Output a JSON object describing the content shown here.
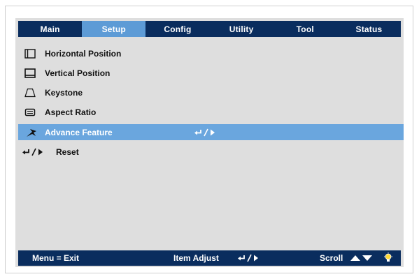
{
  "tabs": [
    {
      "label": "Main"
    },
    {
      "label": "Setup"
    },
    {
      "label": "Config"
    },
    {
      "label": "Utility"
    },
    {
      "label": "Tool"
    },
    {
      "label": "Status"
    }
  ],
  "active_tab": "Setup",
  "menu_items": [
    {
      "label": "Horizontal Position",
      "icon": "horizontal-position-icon"
    },
    {
      "label": "Vertical Position",
      "icon": "vertical-position-icon"
    },
    {
      "label": "Keystone",
      "icon": "keystone-icon"
    },
    {
      "label": "Aspect Ratio",
      "icon": "aspect-ratio-icon"
    },
    {
      "label": "Advance Feature",
      "icon": "advance-feature-icon",
      "selected": true
    },
    {
      "label": "Reset",
      "icon": "enter-right-icon"
    }
  ],
  "statusbar": {
    "exit": "Menu = Exit",
    "item_adjust": "Item Adjust",
    "scroll": "Scroll"
  },
  "colors": {
    "bar": "#0a2d5e",
    "active_tab": "#5d9bd6",
    "selected_row": "#6aa6de",
    "panel": "#dedede"
  }
}
